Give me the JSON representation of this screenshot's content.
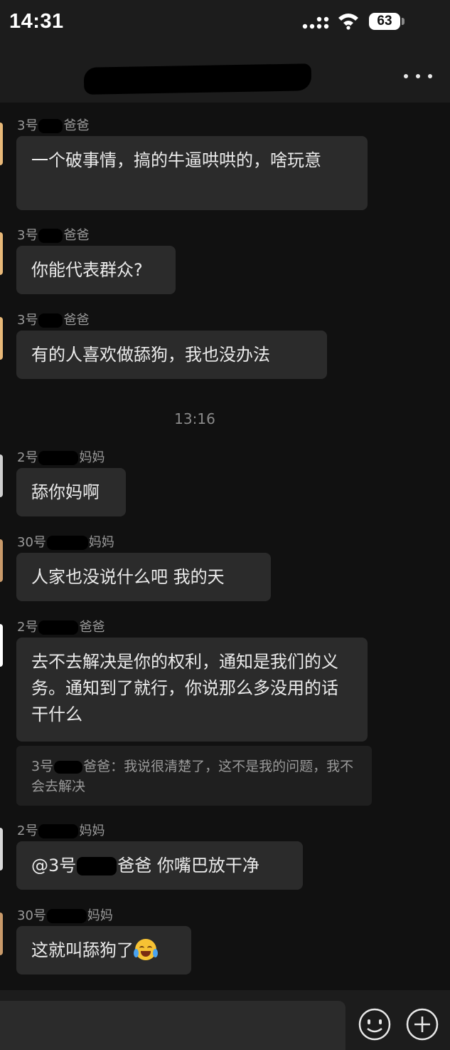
{
  "status_bar": {
    "time": "14:31",
    "battery": "63"
  },
  "chat": {
    "timestamp": "13:16",
    "messages": [
      {
        "prefix": "3号",
        "suffix": "爸爸",
        "text": "一个破事情，搞的牛逼哄哄的，啥玩意"
      },
      {
        "prefix": "3号",
        "suffix": "爸爸",
        "text": "你能代表群众?"
      },
      {
        "prefix": "3号",
        "suffix": "爸爸",
        "text": "有的人喜欢做舔狗，我也没办法"
      },
      {
        "prefix": "2号",
        "suffix": "妈妈",
        "text": "舔你妈啊"
      },
      {
        "prefix": "30号",
        "suffix": "妈妈",
        "text": "人家也没说什么吧 我的天"
      },
      {
        "prefix": "2号",
        "suffix": "爸爸",
        "text": "去不去解决是你的权利，通知是我们的义务。通知到了就行，你说那么多没用的话干什么"
      },
      {
        "prefix": "2号",
        "suffix": "妈妈",
        "text_a": "@3号",
        "text_b": "爸爸 你嘴巴放干净"
      },
      {
        "prefix": "30号",
        "suffix": "妈妈",
        "text": "这就叫舔狗了"
      }
    ],
    "quote": {
      "prefix": "3号",
      "text": "爸爸：我说很清楚了，这不是我的问题，我不会去解决"
    }
  },
  "icons": {
    "more": "more-dots-icon",
    "signal": "signal-icon",
    "wifi": "wifi-icon",
    "emoji": "laughing-crying-emoji",
    "face": "emoji-face-icon",
    "plus": "plus-icon"
  },
  "colors": {
    "background": "#111111",
    "bars": "#1c1c1c",
    "bubble": "#2b2b2b",
    "quote": "#1f1f1f",
    "secondary_text": "#9a9a9a"
  }
}
